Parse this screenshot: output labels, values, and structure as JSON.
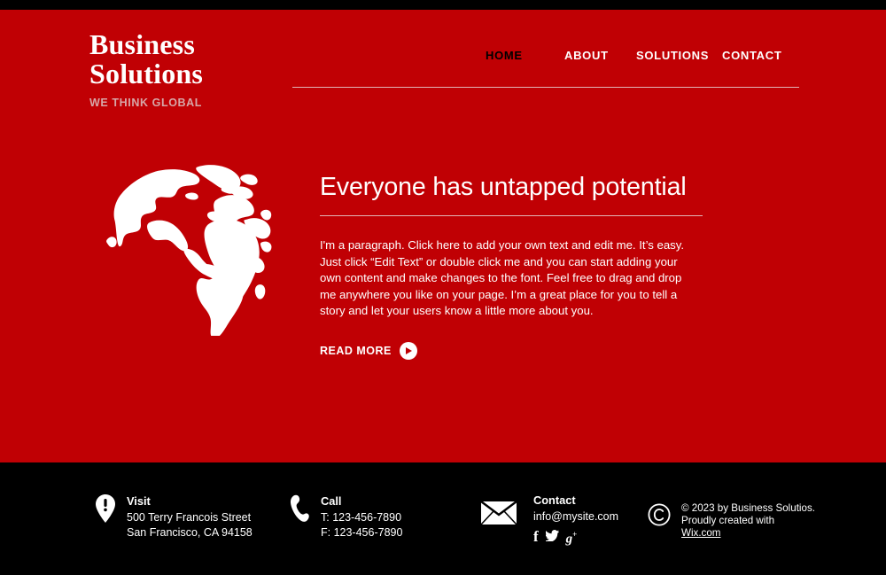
{
  "theme": {
    "brand_red": "#C00004",
    "black": "#000000",
    "white": "#FFFFFF",
    "tagline_color": "#D7A7A8",
    "rule_color": "#E2B5B6"
  },
  "header": {
    "brand_line1": "Business",
    "brand_line2": "Solutions",
    "tagline": "WE THINK GLOBAL",
    "nav": [
      {
        "label": "HOME",
        "active": true
      },
      {
        "label": "ABOUT",
        "active": false
      },
      {
        "label": "SOLUTIONS",
        "active": false
      },
      {
        "label": "CONTACT",
        "active": false
      }
    ]
  },
  "hero": {
    "globe_icon": "world-map-globe-icon",
    "headline": "Everyone has untapped potential",
    "paragraph": "I'm a paragraph. Click here to add your own text and edit me. It’s easy. Just click “Edit Text” or double click me and you can start adding your own content and make changes to the font. Feel free to drag and drop me anywhere you like on your page. I’m a great place for you to tell a story and let your users know a little more about you.",
    "read_more_label": "READ MORE",
    "read_more_icon": "play-circle-icon"
  },
  "footer": {
    "visit": {
      "icon": "map-pin-icon",
      "title": "Visit",
      "line1": "500 Terry Francois Street",
      "line2": "San Francisco, CA 94158"
    },
    "call": {
      "icon": "phone-icon",
      "title": "Call",
      "line1": "T: 123-456-7890",
      "line2": "F: 123-456-7890"
    },
    "contact": {
      "icon": "envelope-icon",
      "title": "Contact",
      "email": "info@mysite.com",
      "social": [
        {
          "name": "facebook-icon",
          "glyph": "f"
        },
        {
          "name": "twitter-icon",
          "glyph": ""
        },
        {
          "name": "googleplus-icon",
          "glyph": "g"
        }
      ]
    },
    "copyright": {
      "icon": "copyright-icon",
      "line1": "© 2023 by Business Solutios.",
      "line2": "Proudly created with",
      "link": "Wix.com"
    }
  }
}
